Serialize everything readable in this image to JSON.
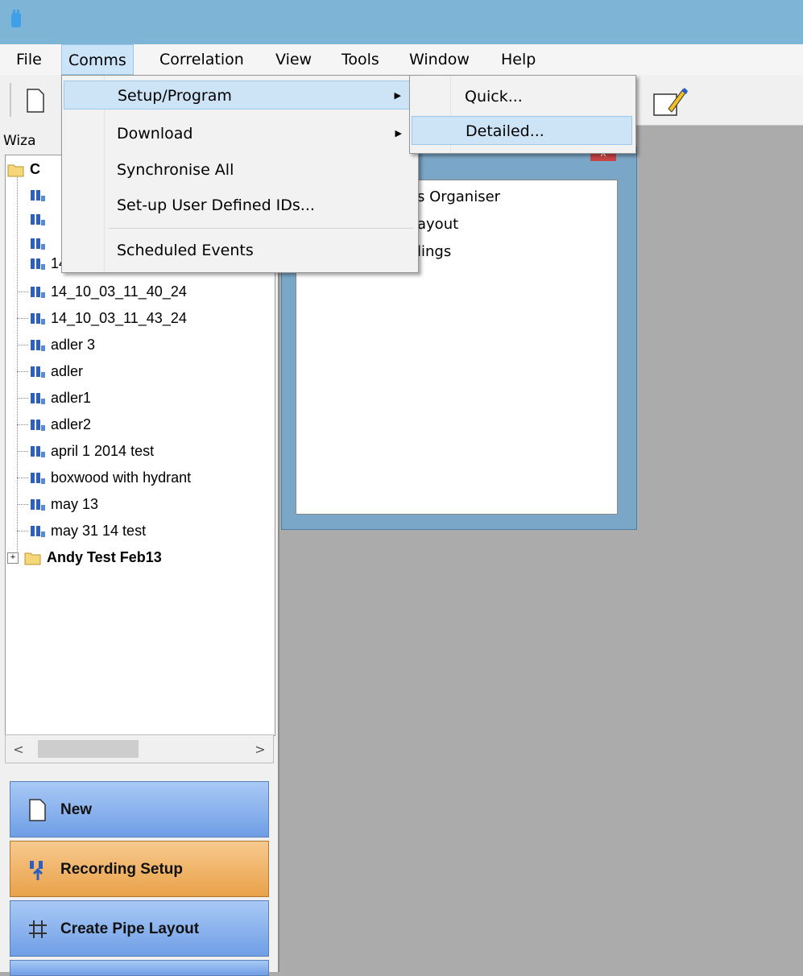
{
  "menubar": {
    "items": [
      "File",
      "Comms",
      "Correlation",
      "View",
      "Tools",
      "Window",
      "Help"
    ]
  },
  "left_panel": {
    "tab_label": "Wiza",
    "tree_root_partial": "C",
    "tree_partial_row": "14_02_17_3_44",
    "tree_items": [
      "14_10_03_11_40_24",
      "14_10_03_11_43_24",
      "adler 3",
      "adler",
      "adler1",
      "adler2",
      "april 1 2014 test",
      "boxwood with hydrant",
      "may 13",
      "may 31 14 test"
    ],
    "folder_label": "Andy Test Feb13",
    "folder_expander": "+"
  },
  "wizard_buttons": {
    "new": "New",
    "recording_setup": "Recording Setup",
    "create_pipe_layout": "Create Pipe Layout"
  },
  "mdi_window": {
    "close_glyph": "x",
    "lines": [
      "s Organiser",
      "ayout",
      "lings"
    ]
  },
  "comms_menu": {
    "items": [
      {
        "label": "Setup/Program",
        "submenu": true
      },
      {
        "label": "Download",
        "submenu": true
      },
      {
        "label": "Synchronise All",
        "submenu": false
      },
      {
        "label": "Set-up User Defined IDs...",
        "submenu": false
      },
      {
        "label": "Scheduled Events",
        "submenu": false
      }
    ]
  },
  "setup_submenu": {
    "items": [
      "Quick...",
      "Detailed..."
    ]
  },
  "scroll": {
    "left": "<",
    "right": ">"
  }
}
